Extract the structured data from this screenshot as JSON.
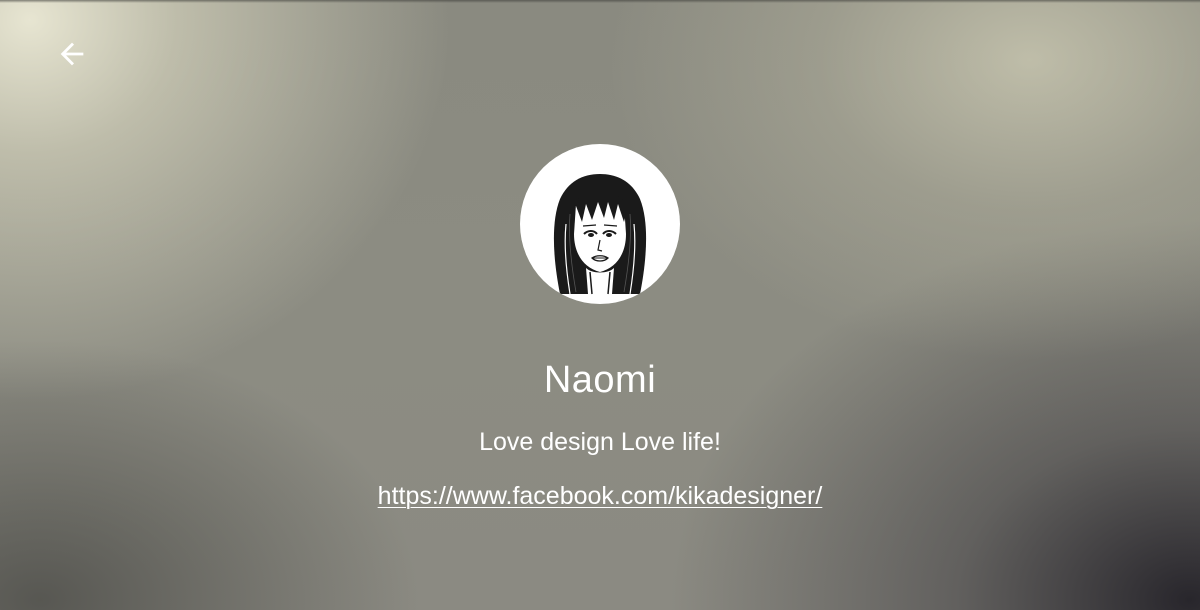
{
  "header": {
    "back_icon": "arrow-left-icon"
  },
  "profile": {
    "avatar_icon": "sketch-portrait-avatar",
    "name": "Naomi",
    "bio": "Love design Love life!",
    "link": "https://www.facebook.com/kikadesigner/"
  },
  "colors": {
    "text": "#ffffff",
    "avatar_background": "#ffffff"
  }
}
